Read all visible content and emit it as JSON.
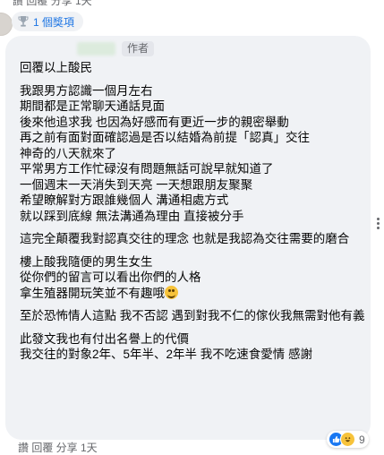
{
  "previous_comment": {
    "actions_cropped": "讚  回覆  分享  1天"
  },
  "award": {
    "icon": "trophy-icon",
    "label": "1 個獎項"
  },
  "comment": {
    "author_badge": "作者",
    "paragraphs": [
      {
        "lines": [
          "回覆以上酸民"
        ]
      },
      {
        "lines": [
          "我跟男方認識一個月左右",
          "期間都是正常聊天通話見面",
          "後來他追求我 也因為好感而有更近一步的親密舉動",
          "再之前有面對面確認過是否以結婚為前提「認真」交往",
          "神奇的八天就來了",
          "平常男方工作忙碌沒有問題無話可說早就知道了",
          "一個週末一天消失到天亮 一天想跟朋友聚聚",
          "希望瞭解對方跟誰幾個人 溝通相處方式",
          "就以踩到底線 無法溝通為理由 直接被分手"
        ]
      },
      {
        "lines": [
          "這完全顛覆我對認真交往的理念 也就是我認為交往需要的磨合"
        ],
        "wrap": true
      },
      {
        "lines": [
          "樓上酸我隨便的男生女生",
          "從你們的留言可以看出你們的人格",
          "拿生殖器開玩笑並不有趣哦"
        ],
        "emoji_after_last": true
      },
      {
        "lines": [
          "至於恐怖情人這點 我不否認 遇到對我不仁的傢伙我無需對他有義"
        ],
        "wrap": true
      },
      {
        "lines": [
          "此發文我也有付出名譽上的代價",
          "我交往的對象2年、5年半、2年半 我不吃速食愛情 感謝"
        ]
      }
    ],
    "reactions": {
      "icons": [
        "like-icon",
        "haha-icon"
      ],
      "count": "9"
    },
    "actions_cropped": "讚  回覆  分享  1天"
  }
}
